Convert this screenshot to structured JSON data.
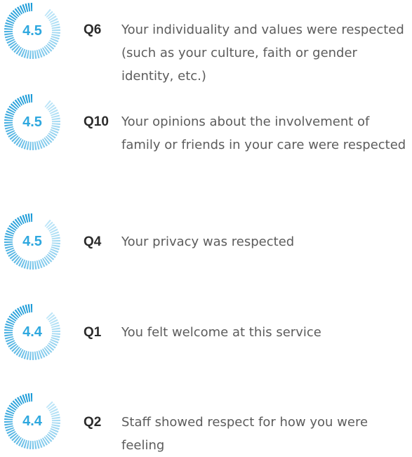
{
  "items": [
    {
      "id": "Q6",
      "score": "4.5",
      "level": 0.9,
      "text": "Your individuality and values were respected (such as your culture, faith or gender identity, etc.)"
    },
    {
      "id": "Q10",
      "score": "4.5",
      "level": 0.9,
      "text": "Your opinions about the involvement of family or friends in your care were respected"
    },
    {
      "id": "Q4",
      "score": "4.5",
      "level": 0.9,
      "text": "Your privacy was respected"
    },
    {
      "id": "Q1",
      "score": "4.4",
      "level": 0.88,
      "text": "You felt welcome at this service"
    },
    {
      "id": "Q2",
      "score": "4.4",
      "level": 0.88,
      "text": "Staff showed respect for how you were feeling"
    }
  ],
  "colors": {
    "gauge_dark": "#1a9ad7",
    "gauge_light": "#bfe6f8",
    "score_text": "#2fa8df",
    "question_id": "#2b2b2b",
    "question_text": "#5c5c5c"
  }
}
